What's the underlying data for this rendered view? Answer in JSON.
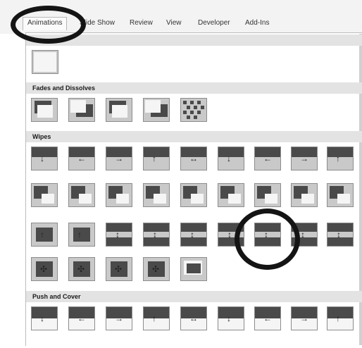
{
  "tabs": [
    "Animations",
    "Slide Show",
    "Review",
    "View",
    "Developer",
    "Add-Ins"
  ],
  "sections": {
    "first": "",
    "fades": "Fades and Dissolves",
    "wipes": "Wipes",
    "push": "Push and Cover"
  },
  "selected_transition": "wipe-diagonal-selected",
  "colors": {
    "highlight_ring": "#141414",
    "section_header": "#e3e3e3",
    "thumb_dark": "#4a4a4a"
  }
}
